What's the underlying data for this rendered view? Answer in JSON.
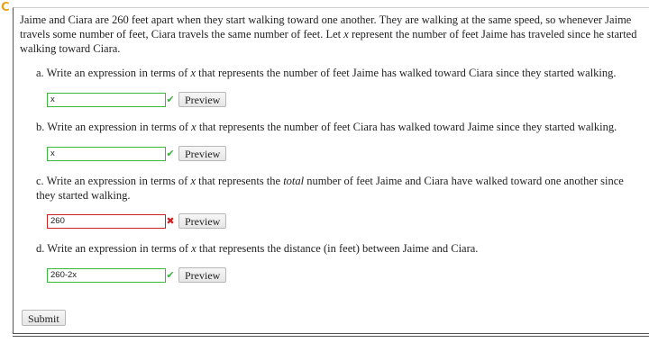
{
  "icons": {
    "corner": "refresh-c-icon",
    "correct": "check-icon",
    "incorrect": "x-mark-icon"
  },
  "colors": {
    "correct_border": "#3cba3c",
    "incorrect_border": "#cc2222",
    "corner_icon": "#e8a21a"
  },
  "problem": {
    "corner_glyph": "C",
    "intro_1": "Jaime and Ciara are 260 feet apart when they start walking toward one another. They are walking at the same speed, so whenever Jaime travels some number of feet, Ciara travels the same number of feet. Let ",
    "intro_var": "x",
    "intro_2": " represent the number of feet Jaime has traveled since he started walking toward Ciara."
  },
  "parts": [
    {
      "prefix": "a. Write an expression in terms of ",
      "var": "x",
      "suffix": " that represents the number of feet Jaime has walked toward Ciara since they started walking.",
      "answer": "x",
      "status": "correct",
      "status_glyph": "✔",
      "preview_label": "Preview"
    },
    {
      "prefix": "b. Write an expression in terms of ",
      "var": "x",
      "suffix": " that represents the number of feet Ciara has walked toward Jaime since they started walking.",
      "answer": "x",
      "status": "correct",
      "status_glyph": "✔",
      "preview_label": "Preview"
    },
    {
      "prefix": "c. Write an expression in terms of ",
      "var": "x",
      "middle": " that represents the ",
      "emph": "total",
      "suffix": " number of feet Jaime and Ciara have walked toward one another since they started walking.",
      "answer": "260",
      "status": "incorrect",
      "status_glyph": "✖",
      "preview_label": "Preview"
    },
    {
      "prefix": "d. Write an expression in terms of ",
      "var": "x",
      "suffix": " that represents the distance (in feet) between Jaime and Ciara.",
      "answer": "260-2x",
      "status": "correct",
      "status_glyph": "✔",
      "preview_label": "Preview"
    }
  ],
  "submit_label": "Submit"
}
